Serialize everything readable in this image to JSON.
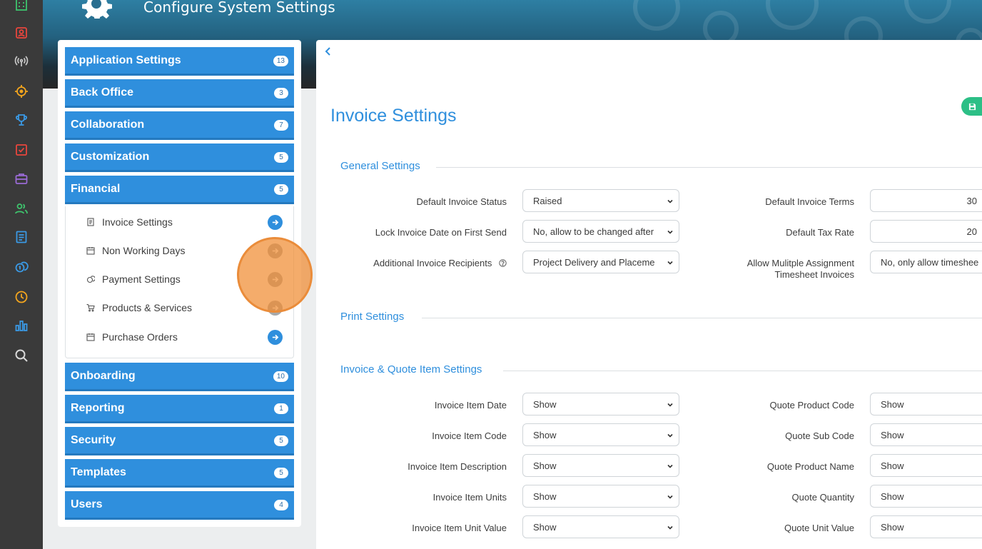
{
  "header": {
    "title": "Configure System Settings"
  },
  "rail": {
    "icons": [
      "building-icon",
      "contact-card-icon",
      "broadcast-icon",
      "target-icon",
      "trophy-icon",
      "checkbox-icon",
      "briefcase-icon",
      "people-icon",
      "document-icon",
      "coins-icon",
      "clock-icon",
      "bar-chart-icon",
      "search-icon"
    ]
  },
  "sidebar": {
    "categories": [
      {
        "label": "Application Settings",
        "count": "13"
      },
      {
        "label": "Back Office",
        "count": "3"
      },
      {
        "label": "Collaboration",
        "count": "7"
      },
      {
        "label": "Customization",
        "count": "5"
      },
      {
        "label": "Financial",
        "count": "5"
      },
      {
        "label": "Onboarding",
        "count": "10"
      },
      {
        "label": "Reporting",
        "count": "1"
      },
      {
        "label": "Security",
        "count": "5"
      },
      {
        "label": "Templates",
        "count": "5"
      },
      {
        "label": "Users",
        "count": "4"
      }
    ],
    "financial_items": [
      {
        "label": "Invoice Settings",
        "icon": "invoice-icon"
      },
      {
        "label": "Non Working Days",
        "icon": "calendar-icon"
      },
      {
        "label": "Payment Settings",
        "icon": "coins-icon"
      },
      {
        "label": "Products & Services",
        "icon": "cart-icon"
      },
      {
        "label": "Purchase Orders",
        "icon": "calendar-icon"
      }
    ]
  },
  "main": {
    "title": "Invoice Settings",
    "sections": {
      "general": "General Settings",
      "print": "Print Settings",
      "items": "Invoice & Quote Item Settings"
    },
    "general_fields": {
      "default_invoice_status": {
        "label": "Default Invoice Status",
        "value": "Raised"
      },
      "lock_invoice_date": {
        "label": "Lock Invoice Date on First Send",
        "value": "No, allow to be changed after"
      },
      "additional_recipients": {
        "label": "Additional Invoice Recipients",
        "value": "Project Delivery and Placeme"
      },
      "default_invoice_terms": {
        "label": "Default Invoice Terms",
        "value": "30"
      },
      "default_tax_rate": {
        "label": "Default Tax Rate",
        "value": "20"
      },
      "allow_multiple_assignment": {
        "label_line1": "Allow Mulitple Assignment",
        "label_line2": "Timesheet Invoices",
        "value": "No, only allow timeshee"
      }
    },
    "item_fields_left": [
      {
        "label": "Invoice Item Date",
        "value": "Show"
      },
      {
        "label": "Invoice Item Code",
        "value": "Show"
      },
      {
        "label": "Invoice Item Description",
        "value": "Show"
      },
      {
        "label": "Invoice Item Units",
        "value": "Show"
      },
      {
        "label": "Invoice Item Unit Value",
        "value": "Show"
      }
    ],
    "item_fields_right": [
      {
        "label": "Quote Product Code",
        "value": "Show"
      },
      {
        "label": "Quote Sub Code",
        "value": "Show"
      },
      {
        "label": "Quote Product Name",
        "value": "Show"
      },
      {
        "label": "Quote Quantity",
        "value": "Show"
      },
      {
        "label": "Quote Unit Value",
        "value": "Show"
      }
    ]
  },
  "colors": {
    "accent": "#2f8fdd",
    "save": "#2cbf86",
    "rail": "#3a3a3a",
    "highlight": "#ea8c3a"
  }
}
